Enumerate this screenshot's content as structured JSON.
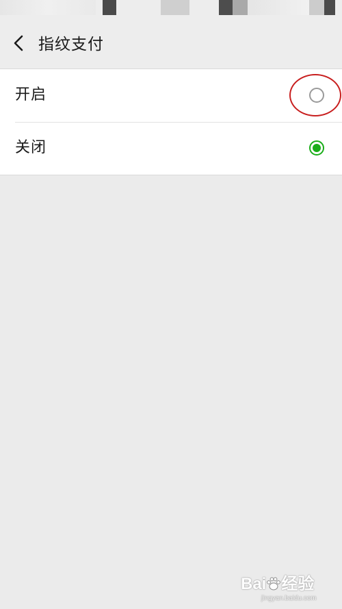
{
  "nav": {
    "title": "指纹支付",
    "back_icon": "chevron-left-icon"
  },
  "options": [
    {
      "label": "开启",
      "selected": false
    },
    {
      "label": "关闭",
      "selected": true
    }
  ],
  "colors": {
    "accent_green": "#1aad19",
    "highlight_red": "#c81e1e",
    "background": "#ebebeb"
  },
  "watermark": {
    "logo_left": "Bai",
    "logo_right": "经验",
    "url": "jingyan.baidu.com"
  }
}
